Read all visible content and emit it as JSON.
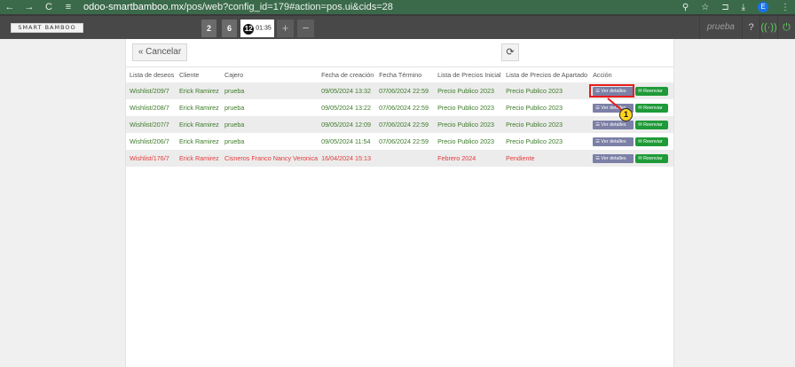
{
  "browser": {
    "back_icon": "←",
    "forward_icon": "→",
    "reload_icon": "C",
    "site_icon": "≡",
    "url_host": "odoo-smartbamboo.mx",
    "url_path": "/pos/web?config_id=179#action=pos.ui&cids=28",
    "zoom_icon": "⚲",
    "star_icon": "☆",
    "ext_icon": "⊐",
    "download_icon": "⤓",
    "profile_initial": "E",
    "menu_icon": "⋮"
  },
  "pos_header": {
    "logo_text": "SMART BAMBOO",
    "orders": [
      {
        "label": "2"
      },
      {
        "label": "6"
      },
      {
        "badge": "12",
        "time": "01:35"
      }
    ],
    "add_label": "+",
    "remove_label": "−",
    "user": "prueba",
    "help_label": "?",
    "wifi_label": "((·))",
    "lock_label": "⏻"
  },
  "toolbar": {
    "cancel_label": "« Cancelar",
    "refresh_label": "⟳"
  },
  "table": {
    "headers": [
      "Lista de deseos",
      "Cliente",
      "Cajero",
      "Fecha de creación",
      "Fecha Término",
      "Lista de Precios Inicial",
      "Lista de Precios de Apartado",
      "Acción"
    ],
    "view_label": "Ver detalles",
    "resend_label": "Reenviar",
    "rows": [
      {
        "id": "Wishlist/209/7",
        "client": "Erick Ramirez",
        "cashier": "prueba",
        "created": "09/05/2024 13:32",
        "end": "07/06/2024 22:59",
        "pricelist": "Precio Publico 2023",
        "layaway": "Precio Publico 2023"
      },
      {
        "id": "Wishlist/208/7",
        "client": "Erick Ramirez",
        "cashier": "prueba",
        "created": "09/05/2024 13:22",
        "end": "07/06/2024 22:59",
        "pricelist": "Precio Publico 2023",
        "layaway": "Precio Publico 2023"
      },
      {
        "id": "Wishlist/207/7",
        "client": "Erick Ramirez",
        "cashier": "prueba",
        "created": "09/05/2024 12:09",
        "end": "07/06/2024 22:59",
        "pricelist": "Precio Publico 2023",
        "layaway": "Precio Publico 2023"
      },
      {
        "id": "Wishlist/206/7",
        "client": "Erick Ramirez",
        "cashier": "prueba",
        "created": "09/05/2024 11:54",
        "end": "07/06/2024 22:59",
        "pricelist": "Precio Publico 2023",
        "layaway": "Precio Publico 2023"
      },
      {
        "id": "Wishlist/176/7",
        "client": "Erick Ramirez",
        "cashier": "Cisneros Franco Nancy Veronica",
        "created": "16/04/2024 15:13",
        "end": "",
        "pricelist": "Febrero 2024",
        "layaway": "Pendiente"
      }
    ]
  },
  "annotation": {
    "marker_number": "1"
  },
  "colors": {
    "active_row": "#3d7a2a",
    "pending_row": "#e23b3b",
    "view_button": "#7c80a6",
    "resend_button": "#1f9a38",
    "highlight": "#e81c1c"
  }
}
